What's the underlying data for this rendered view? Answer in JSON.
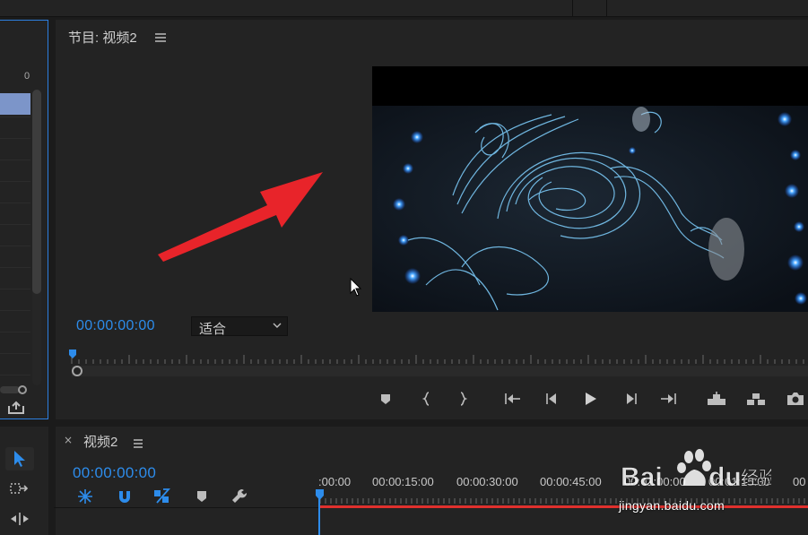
{
  "left_panel": {
    "zero_label": "0"
  },
  "program_monitor": {
    "title": "节目: 视频2",
    "timecode": "00:00:00:00",
    "fit_value": "适合",
    "transport_buttons": [
      "add-marker",
      "mark-in",
      "mark-out",
      "go-to-in",
      "step-back",
      "play",
      "step-forward",
      "go-to-out",
      "lift",
      "extract",
      "export-frame"
    ]
  },
  "timeline": {
    "close_symbol": "×",
    "title": "视频2",
    "timecode": "00:00:00:00",
    "tick_labels": [
      ":00:00",
      "00:00:15:00",
      "00:00:30:00",
      "00:00:45:00",
      "00:01:00:00",
      "00:01:15:00",
      "00"
    ]
  },
  "watermark": {
    "brand": "Baidu经验",
    "url": "jingyan.baidu.com"
  },
  "colors": {
    "accent": "#2d8ceb",
    "arrow": "#e8242a",
    "work_area": "#e0302d",
    "panel": "#232323",
    "background": "#1b1b1b"
  }
}
